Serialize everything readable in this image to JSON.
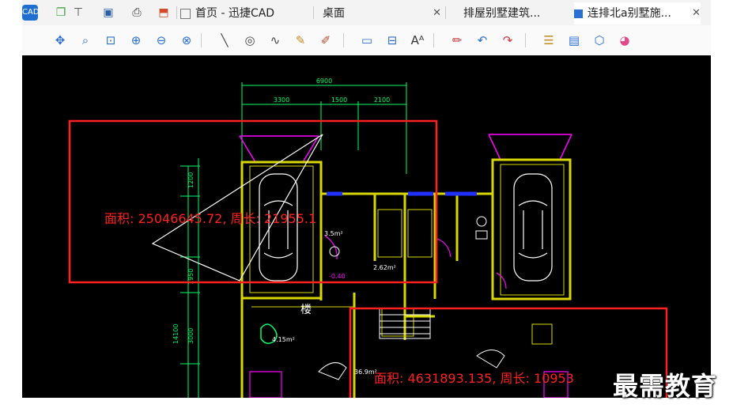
{
  "tabs": [
    {
      "label": "首页 - 迅捷CAD",
      "icon": "home-icon",
      "active": false
    },
    {
      "label": "桌面",
      "icon": "folder-icon",
      "active": false
    },
    {
      "label": "排屋别墅建筑...",
      "icon": "drawing-icon",
      "active": false
    },
    {
      "label": "连排北a别墅施...",
      "icon": "drawing-icon",
      "active": true
    }
  ],
  "quick_access": [
    "new-icon",
    "open-icon",
    "save-icon",
    "print-icon",
    "export-icon"
  ],
  "toolbar_icons": [
    "pan-icon",
    "zoom-realtime-icon",
    "zoom-window-icon",
    "zoom-in-icon",
    "zoom-out-icon",
    "zoom-extents-icon",
    "line-icon",
    "circle-icon",
    "polyline-icon",
    "sketch-icon",
    "erase-icon",
    "rectangle-icon",
    "text-block-icon",
    "text-size-icon",
    "markup-icon",
    "undo-icon",
    "redo-icon",
    "layer-icon",
    "layer-manager-icon",
    "3d-view-icon",
    "color-icon"
  ],
  "drawing": {
    "dim_total": "6900",
    "dim_parts": [
      "3300",
      "1500",
      "2100"
    ],
    "dim_vertical": [
      "1200",
      "1950",
      "3000",
      "14100"
    ],
    "area_label_1": "面积: 25046645.72, 周长: 21955.1",
    "area_label_2": "面积: 4631893.135, 周长: 10953",
    "room_labels": [
      "2.62m²",
      "3.5m²",
      "4.15m²",
      "-0.40",
      "36.9m²"
    ],
    "stair_label": "楼"
  },
  "colors": {
    "canvas_bg": "#000000",
    "selection": "#ff2020",
    "walls": "#d8d800",
    "dimension": "#00ff66",
    "magenta": "#ff00ff",
    "window": "#2030ff"
  },
  "watermark": "最需教育"
}
